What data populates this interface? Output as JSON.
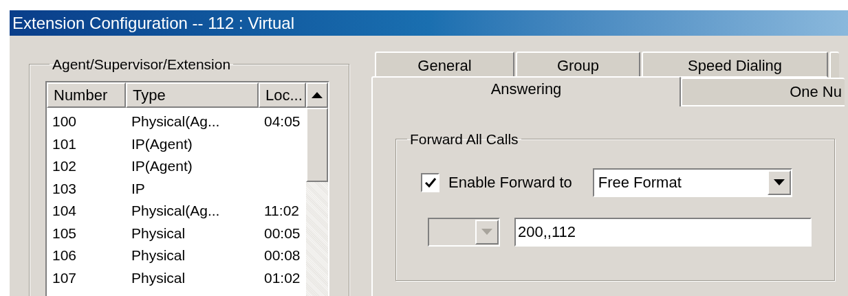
{
  "window": {
    "title": "Extension Configuration -- 112 : Virtual"
  },
  "agent_group": {
    "title": "Agent/Supervisor/Extension",
    "columns": [
      "Number",
      "Type",
      "Loc..."
    ],
    "rows": [
      {
        "number": "100",
        "type": "Physical(Ag...",
        "column_3": "04:05"
      },
      {
        "number": "101",
        "type": "IP(Agent)"
      },
      {
        "number": "102",
        "type": "IP(Agent)"
      },
      {
        "number": "103",
        "type": "IP"
      },
      {
        "number": "104",
        "type": "Physical(Ag...",
        "column_3": "11:02"
      },
      {
        "number": "105",
        "type": "Physical",
        "column_3": "00:05"
      },
      {
        "number": "106",
        "type": "Physical",
        "column_3": "00:08"
      },
      {
        "number": "107",
        "type": "Physical",
        "column_3": "01:02"
      }
    ]
  },
  "tab_rows": [
    {
      "tabs": [
        {
          "label": "General",
          "selected": false
        },
        {
          "label": "Group",
          "selected": false
        },
        {
          "label": "Speed Dialing",
          "selected": false
        }
      ]
    },
    {
      "tabs": [
        {
          "label": "Answering",
          "selected": true
        },
        {
          "label": "One Nu",
          "selected": false
        }
      ]
    }
  ],
  "forward_all_calls": {
    "title": "Forward All Calls",
    "enable_forward": {
      "label": "Enable Forward to",
      "checked": true
    },
    "forward_type": {
      "value": "Free Format"
    },
    "secondary_combo": {
      "disabled": true
    },
    "number_field": {
      "value": "200,,112"
    }
  }
}
